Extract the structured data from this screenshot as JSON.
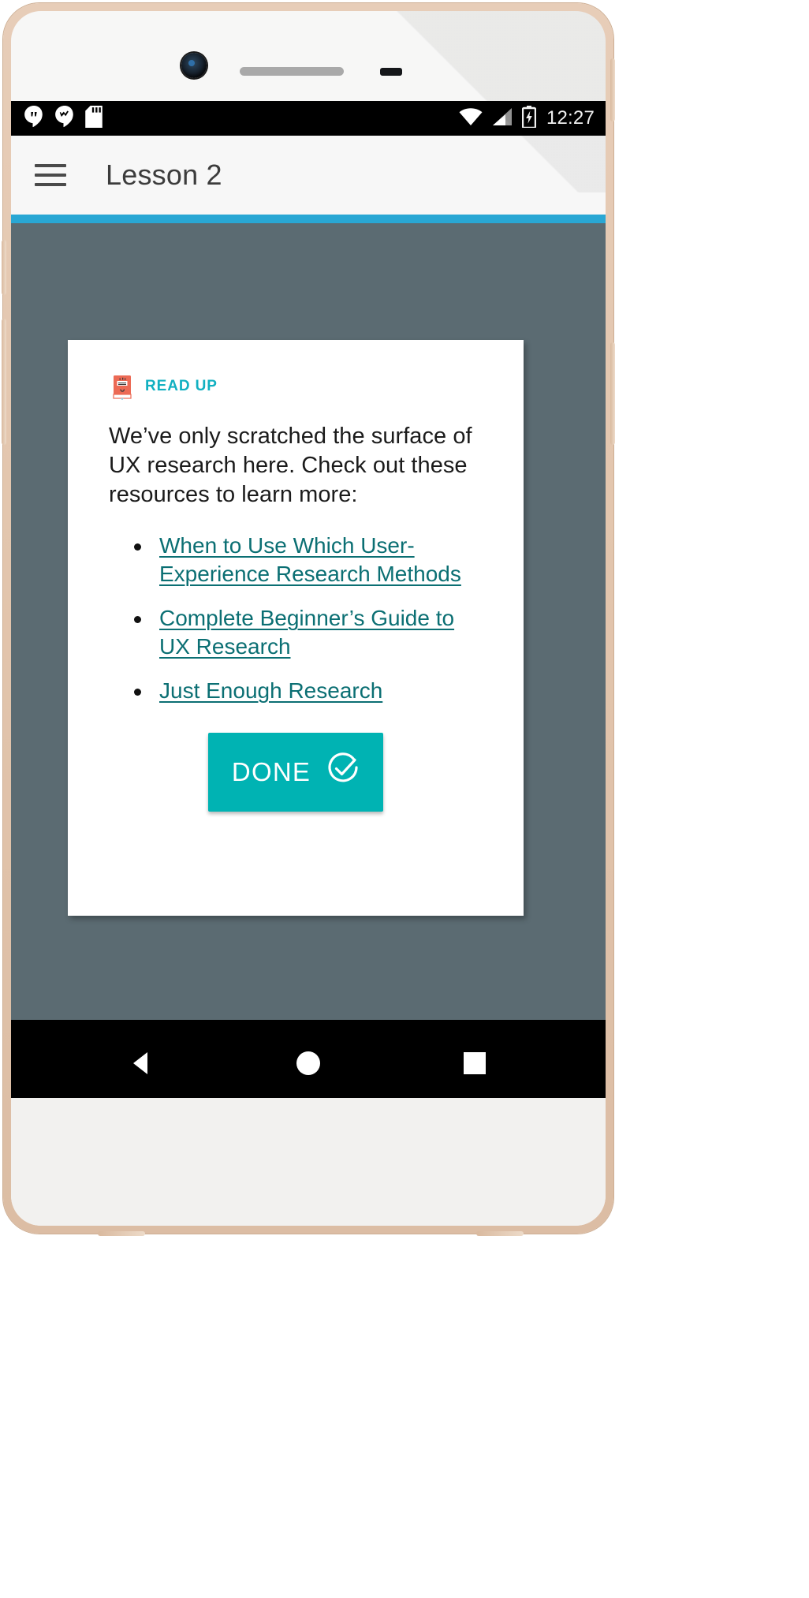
{
  "device": {
    "camera": "front-camera",
    "speaker": "earpiece-speaker",
    "sensor": "proximity-sensor"
  },
  "status_bar": {
    "left_icons": [
      {
        "name": "hangouts-icon",
        "label": "Hangouts"
      },
      {
        "name": "tasks-check-icon",
        "label": "Tasks"
      },
      {
        "name": "sd-card-icon",
        "label": "SD card"
      }
    ],
    "right_icons": [
      {
        "name": "wifi-icon",
        "label": "Wi-Fi"
      },
      {
        "name": "cellular-signal-icon",
        "label": "Cellular signal"
      },
      {
        "name": "battery-charging-icon",
        "label": "Battery charging"
      }
    ],
    "clock": "12:27",
    "background_color": "#000000",
    "foreground_color": "#ffffff"
  },
  "app_bar": {
    "menu_icon": "hamburger-menu-icon",
    "title": "Lesson 2",
    "background_color": "#f7f7f7",
    "accent_color": "#29a7d4"
  },
  "content": {
    "background_color": "#5b6b72"
  },
  "card": {
    "header": {
      "icon": "open-book-icon",
      "label": "READ UP",
      "label_color": "#11b0c1"
    },
    "paragraph": "We’ve only scratched the surface of UX research here. Check out these resources to learn more:",
    "resources": [
      {
        "label": "When to Use Which User-Experience Research Methods"
      },
      {
        "label": "Complete Beginner’s Guide to UX Research"
      },
      {
        "label": "Just Enough Research"
      }
    ],
    "link_color": "#0b6f73",
    "done_button": {
      "label": "DONE",
      "icon": "check-circle-icon",
      "background_color": "#00b3b3",
      "text_color": "#ffffff"
    }
  },
  "nav_bar": {
    "buttons": [
      {
        "name": "back-button",
        "icon": "triangle-back-icon"
      },
      {
        "name": "home-button",
        "icon": "circle-home-icon"
      },
      {
        "name": "recents-button",
        "icon": "square-recents-icon"
      }
    ],
    "background_color": "#000000"
  }
}
